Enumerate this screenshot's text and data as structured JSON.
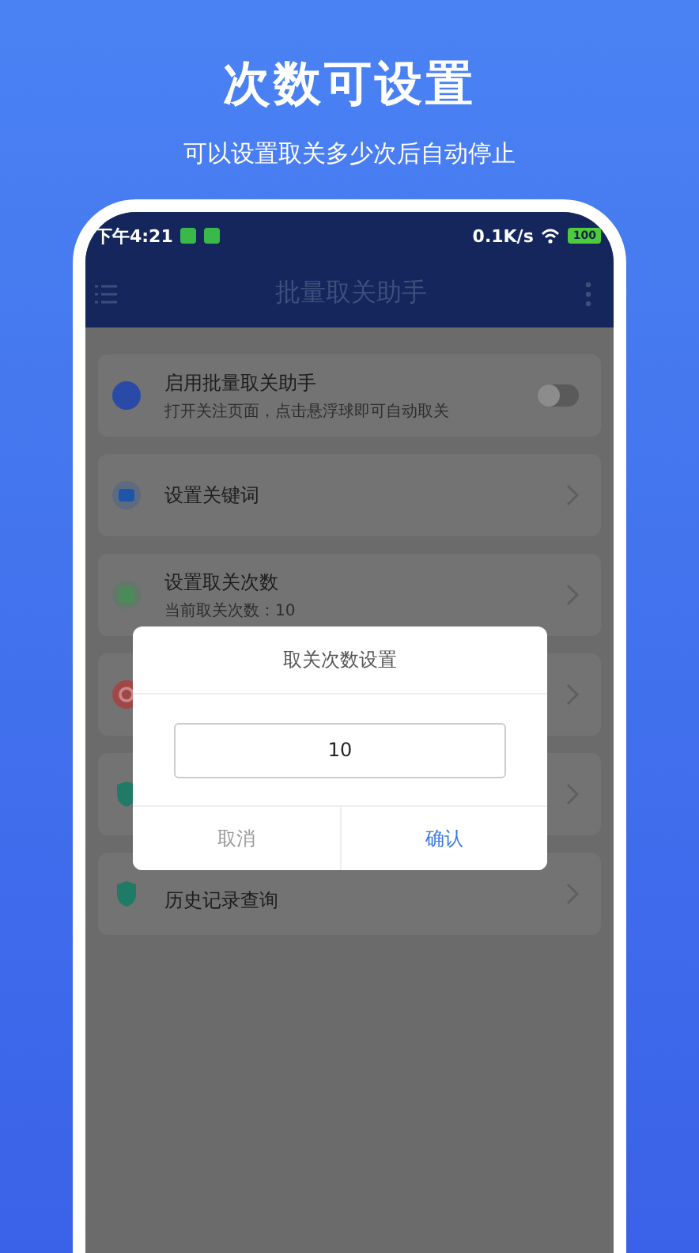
{
  "header": {
    "title": "次数可设置",
    "subtitle": "可以设置取关多少次后自动停止"
  },
  "status_bar": {
    "time": "下午4:21",
    "speed": "0.1K/s",
    "battery": "100"
  },
  "app_bar": {
    "title": "批量取关助手"
  },
  "settings": [
    {
      "kind": "toggle",
      "color": "#2a4aa8",
      "title": "启用批量取关助手",
      "subtitle": "打开关注页面，点击悬浮球即可自动取关",
      "on": false
    },
    {
      "kind": "link",
      "color": "#1f55a8",
      "title": "设置关键词"
    },
    {
      "kind": "link",
      "color": "#4d8a5a",
      "title": "设置取关次数",
      "subtitle": "当前取关次数：10"
    },
    {
      "kind": "link",
      "color": "#a04848"
    },
    {
      "kind": "link",
      "color": "#1f7a66"
    },
    {
      "kind": "link",
      "color": "#1f7a66",
      "title": "历史记录查询"
    }
  ],
  "dialog": {
    "title": "取关次数设置",
    "value": "10",
    "buttons": [
      {
        "label": "取消",
        "kind": "cancel"
      },
      {
        "label": "确认",
        "kind": "confirm"
      }
    ]
  }
}
